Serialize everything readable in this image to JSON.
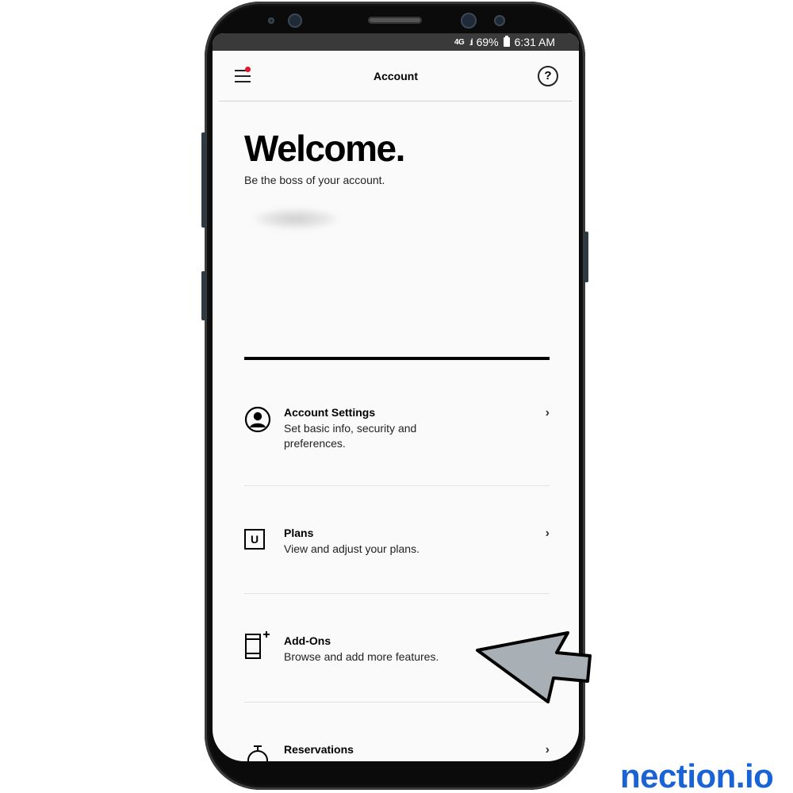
{
  "status_bar": {
    "network": "4G",
    "battery": "69%",
    "time": "6:31 AM"
  },
  "app_bar": {
    "title": "Account",
    "help_label": "?"
  },
  "hero": {
    "title": "Welcome.",
    "subtitle": "Be the boss of your account."
  },
  "menu_items": [
    {
      "title": "Account Settings",
      "description": "Set basic info, security and preferences.",
      "icon": "person-circle-icon"
    },
    {
      "title": "Plans",
      "description": "View and adjust your plans.",
      "icon": "plan-icon",
      "icon_label": "U"
    },
    {
      "title": "Add-Ons",
      "description": "Browse and add more features.",
      "icon": "phone-add-icon"
    },
    {
      "title": "Reservations",
      "description": "",
      "icon": "stopwatch-icon"
    }
  ],
  "chevron": "›",
  "watermark": "nection.io",
  "colors": {
    "notification_dot": "#e0162b",
    "watermark": "#1a63d6",
    "arrow_fill": "#a8b0b5"
  }
}
